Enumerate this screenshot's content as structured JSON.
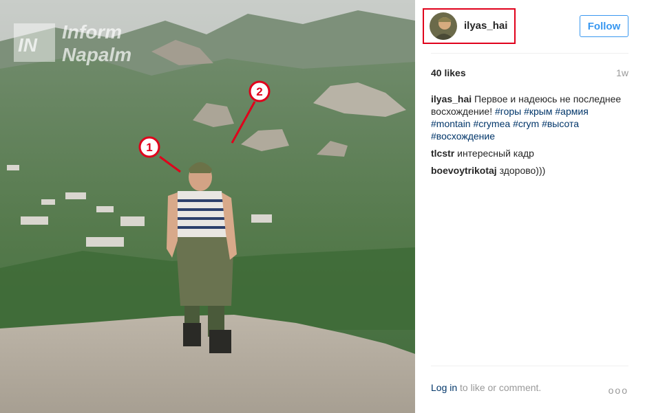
{
  "photo": {
    "watermark_top": "Inform",
    "watermark_bottom": "Napalm",
    "watermark_badge": "IN",
    "markers": [
      {
        "number": "1"
      },
      {
        "number": "2"
      }
    ]
  },
  "post": {
    "username": "ilyas_hai",
    "follow_label": "Follow",
    "likes": "40 likes",
    "age": "1w",
    "caption": {
      "author": "ilyas_hai",
      "text": "Первое и надеюсь не последнее восхождение!",
      "tags": [
        "#горы",
        "#крым",
        "#армия",
        "#montain",
        "#crymea",
        "#crym",
        "#высота",
        "#восхождение"
      ]
    },
    "comments": [
      {
        "author": "tlcstr",
        "text": "интересный кадр"
      },
      {
        "author": "boevoytrikotaj",
        "text": "здорово)))"
      }
    ],
    "login_link": "Log in",
    "login_suffix": "to like or comment.",
    "more_glyph": "ooo"
  }
}
